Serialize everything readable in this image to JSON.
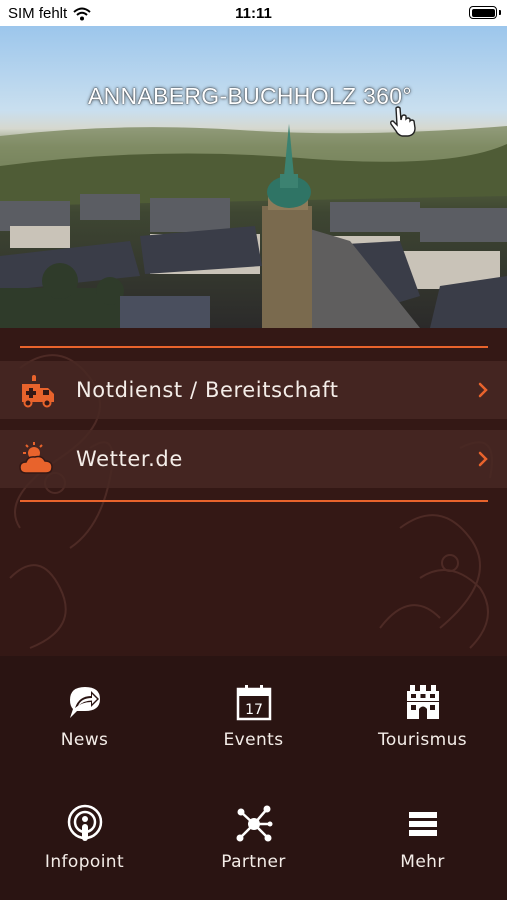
{
  "status_bar": {
    "carrier": "SIM fehlt",
    "time": "11:11"
  },
  "hero": {
    "title": "ANNABERG-BUCHHOLZ 360°"
  },
  "menu": {
    "items": [
      {
        "label": "Notdienst / Bereitschaft",
        "icon": "ambulance-icon"
      },
      {
        "label": "Wetter.de",
        "icon": "weather-icon"
      }
    ]
  },
  "colors": {
    "accent": "#e8632c",
    "background": "#2a1412",
    "panel": "#341815"
  },
  "grid": {
    "tiles": [
      {
        "label": "News",
        "icon": "news-icon"
      },
      {
        "label": "Events",
        "icon": "calendar-icon"
      },
      {
        "label": "Tourismus",
        "icon": "building-icon"
      },
      {
        "label": "Infopoint",
        "icon": "infopoint-icon"
      },
      {
        "label": "Partner",
        "icon": "network-icon"
      },
      {
        "label": "Mehr",
        "icon": "menu-icon"
      }
    ],
    "calendar_day": "17"
  }
}
